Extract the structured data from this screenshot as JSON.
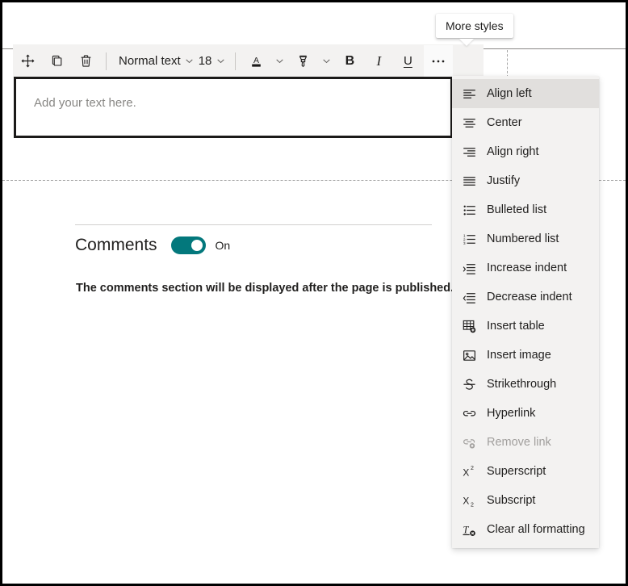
{
  "toolbar": {
    "move_label": "Move web part",
    "duplicate_label": "Duplicate web part",
    "delete_label": "Delete web part",
    "style_value": "Normal text",
    "font_size_value": "18",
    "font_color_label": "Font color",
    "highlight_label": "Highlight color",
    "bold_label": "B",
    "italic_label": "I",
    "underline_label": "U",
    "more_label": "•••"
  },
  "tooltip": {
    "text": "More styles"
  },
  "editor": {
    "placeholder": "Add your text here."
  },
  "comments": {
    "title": "Comments",
    "toggle_state_label": "On",
    "toggle_on": true,
    "note": "The comments section will be displayed after the page is published."
  },
  "menu": {
    "items": [
      {
        "label": "Align left",
        "icon": "align-left-icon",
        "active": true,
        "disabled": false
      },
      {
        "label": "Center",
        "icon": "align-center-icon",
        "active": false,
        "disabled": false
      },
      {
        "label": "Align right",
        "icon": "align-right-icon",
        "active": false,
        "disabled": false
      },
      {
        "label": "Justify",
        "icon": "align-justify-icon",
        "active": false,
        "disabled": false
      },
      {
        "label": "Bulleted list",
        "icon": "bulleted-list-icon",
        "active": false,
        "disabled": false
      },
      {
        "label": "Numbered list",
        "icon": "numbered-list-icon",
        "active": false,
        "disabled": false
      },
      {
        "label": "Increase indent",
        "icon": "increase-indent-icon",
        "active": false,
        "disabled": false
      },
      {
        "label": "Decrease indent",
        "icon": "decrease-indent-icon",
        "active": false,
        "disabled": false
      },
      {
        "label": "Insert table",
        "icon": "insert-table-icon",
        "active": false,
        "disabled": false
      },
      {
        "label": "Insert image",
        "icon": "insert-image-icon",
        "active": false,
        "disabled": false
      },
      {
        "label": "Strikethrough",
        "icon": "strikethrough-icon",
        "active": false,
        "disabled": false
      },
      {
        "label": "Hyperlink",
        "icon": "hyperlink-icon",
        "active": false,
        "disabled": false
      },
      {
        "label": "Remove link",
        "icon": "remove-link-icon",
        "active": false,
        "disabled": true
      },
      {
        "label": "Superscript",
        "icon": "superscript-icon",
        "active": false,
        "disabled": false
      },
      {
        "label": "Subscript",
        "icon": "subscript-icon",
        "active": false,
        "disabled": false
      },
      {
        "label": "Clear all formatting",
        "icon": "clear-formatting-icon",
        "active": false,
        "disabled": false
      }
    ]
  },
  "colors": {
    "toggle_on": "#03787c",
    "toolbar_bg": "#f3f2f1",
    "menu_bg": "#f3f2f1",
    "menu_hover_bg": "#e1dfdd",
    "text": "#201f1e",
    "disabled_text": "#a19f9d"
  }
}
